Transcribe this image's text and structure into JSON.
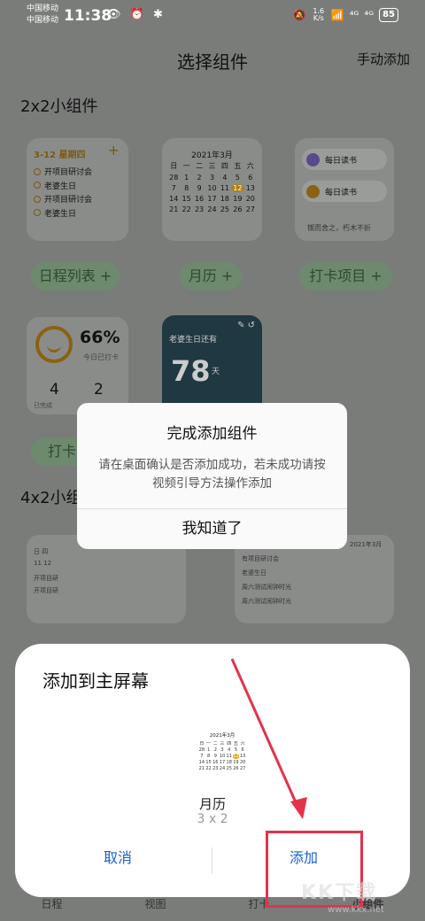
{
  "status": {
    "carrier1": "中国移动",
    "carrier2": "中国移动",
    "time": "11:38",
    "left_icons": "👁 ⏰ ✱",
    "speed_value": "1.6",
    "speed_unit": "K/s",
    "signal1": "⁴ᴳ",
    "signal2": "⁴ᴳ",
    "battery": "85"
  },
  "header": {
    "title": "选择组件",
    "manual_add": "手动添加"
  },
  "sections": {
    "two_by_two": "2x2小组件",
    "four_by_two": "4x2小组件"
  },
  "schedule_widget": {
    "date": "3-12  星期四",
    "plus": "+",
    "items": [
      "开项目研讨会",
      "老婆生日",
      "开项目研讨会",
      "老婆生日"
    ]
  },
  "month_widget": {
    "title": "2021年3月",
    "weekdays": [
      "日",
      "一",
      "二",
      "三",
      "四",
      "五",
      "六"
    ],
    "days": [
      "28",
      "1",
      "2",
      "3",
      "4",
      "5",
      "6",
      "7",
      "8",
      "9",
      "10",
      "11",
      "12",
      "13",
      "14",
      "15",
      "16",
      "17",
      "18",
      "19",
      "20",
      "21",
      "22",
      "23",
      "24",
      "25",
      "26",
      "27"
    ],
    "today": "12"
  },
  "checkin_widget": {
    "items": [
      "每日读书",
      "每日读书"
    ],
    "quote": "锲而舍之，朽木不折"
  },
  "pills": [
    "日程列表 +",
    "月历 +",
    "打卡项目 +",
    "打卡"
  ],
  "percent_widget": {
    "percent": "66%",
    "subtitle": "今日已打卡",
    "done_count": "4",
    "other_count": "2",
    "done_label": "已完成"
  },
  "photo_widget": {
    "label": "老婆生日还有",
    "number": "78",
    "unit": "天"
  },
  "big_left_widget": {
    "weekdays": "日    四",
    "dates": "11    12",
    "rows": [
      "开项目研",
      "开项目研"
    ]
  },
  "big_right_widget": {
    "title": "2021年3月",
    "rows": [
      "有项目研讨会",
      "老婆生日",
      "周六测试闹钟时光",
      "周六测试闹钟时光"
    ]
  },
  "dialog": {
    "title": "完成添加组件",
    "message": "请在桌面确认是否添加成功，若未成功请按视频引导方法操作添加",
    "button": "我知道了"
  },
  "sheet": {
    "title": "添加到主屏幕",
    "preview_title": "2021年3月",
    "preview_name": "月历",
    "preview_size": "3 x 2",
    "cancel": "取消",
    "add": "添加"
  },
  "bottom_nav": [
    "日程",
    "视图",
    "打卡",
    "小组件"
  ],
  "watermark": {
    "text": "KK下载",
    "url": "www.kkx.net"
  },
  "colors": {
    "accent_blue": "#1a5fd6",
    "annotation_red": "#e3324a",
    "widget_gold": "#f0a500"
  }
}
